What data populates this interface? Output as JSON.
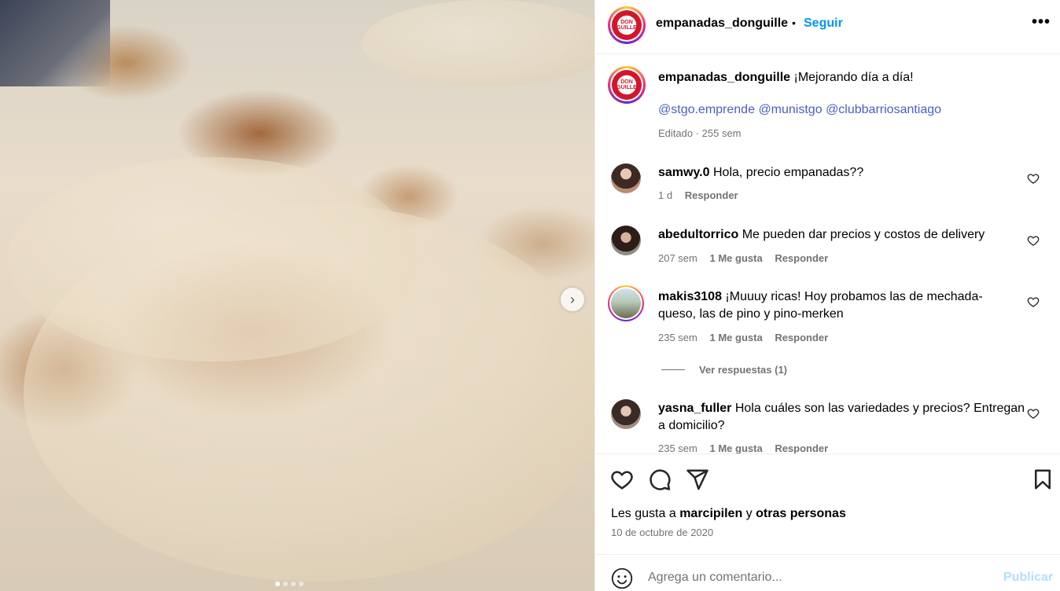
{
  "post": {
    "username": "empanadas_donguille",
    "follow_label": "Seguir",
    "bullet": "•",
    "more": "•••",
    "logo_text": "DON GUILLE",
    "caption_text": "¡Mejorando día a día!",
    "mentions": [
      "@stgo.emprende",
      "@munistgo",
      "@clubbarriosantiago"
    ],
    "caption_meta": "Editado · 255 sem",
    "next": "›",
    "carousel_dots": 4
  },
  "comments": [
    {
      "username": "samwy.0",
      "text": "Hola, precio empanadas??",
      "time": "1 d",
      "likes": "",
      "reply": "Responder"
    },
    {
      "username": "abedultorrico",
      "text": "Me pueden dar precios y costos de delivery",
      "time": "207 sem",
      "likes": "1 Me gusta",
      "reply": "Responder"
    },
    {
      "username": "makis3108",
      "text": "¡Muuuy ricas! Hoy probamos las de mechada-",
      "text2": "queso, las de pino y pino-merken",
      "time": "235 sem",
      "likes": "1 Me gusta",
      "reply": "Responder"
    },
    {
      "username": "yasna_fuller",
      "text": "Hola cuáles son las variedades y precios? Entregan",
      "text2": "a domicilio?",
      "time": "235 sem",
      "likes": "1 Me gusta",
      "reply": "Responder"
    }
  ],
  "view_replies": "Ver respuestas (1)",
  "footer": {
    "likes_prefix": "Les gusta a",
    "liker": "marcipilen",
    "likes_and": "y",
    "others": "otras personas",
    "date": "10 de octubre de 2020",
    "comment_placeholder": "Agrega un comentario...",
    "publish": "Publicar"
  },
  "colors": {
    "link": "#0095f6",
    "mention": "#4a5ec8",
    "meta": "#737373",
    "publish_disabled": "#b2dffc"
  },
  "icons": [
    "heart-icon",
    "comment-icon",
    "share-icon",
    "bookmark-icon",
    "emoji-icon",
    "more-icon",
    "chevron-right-icon"
  ]
}
